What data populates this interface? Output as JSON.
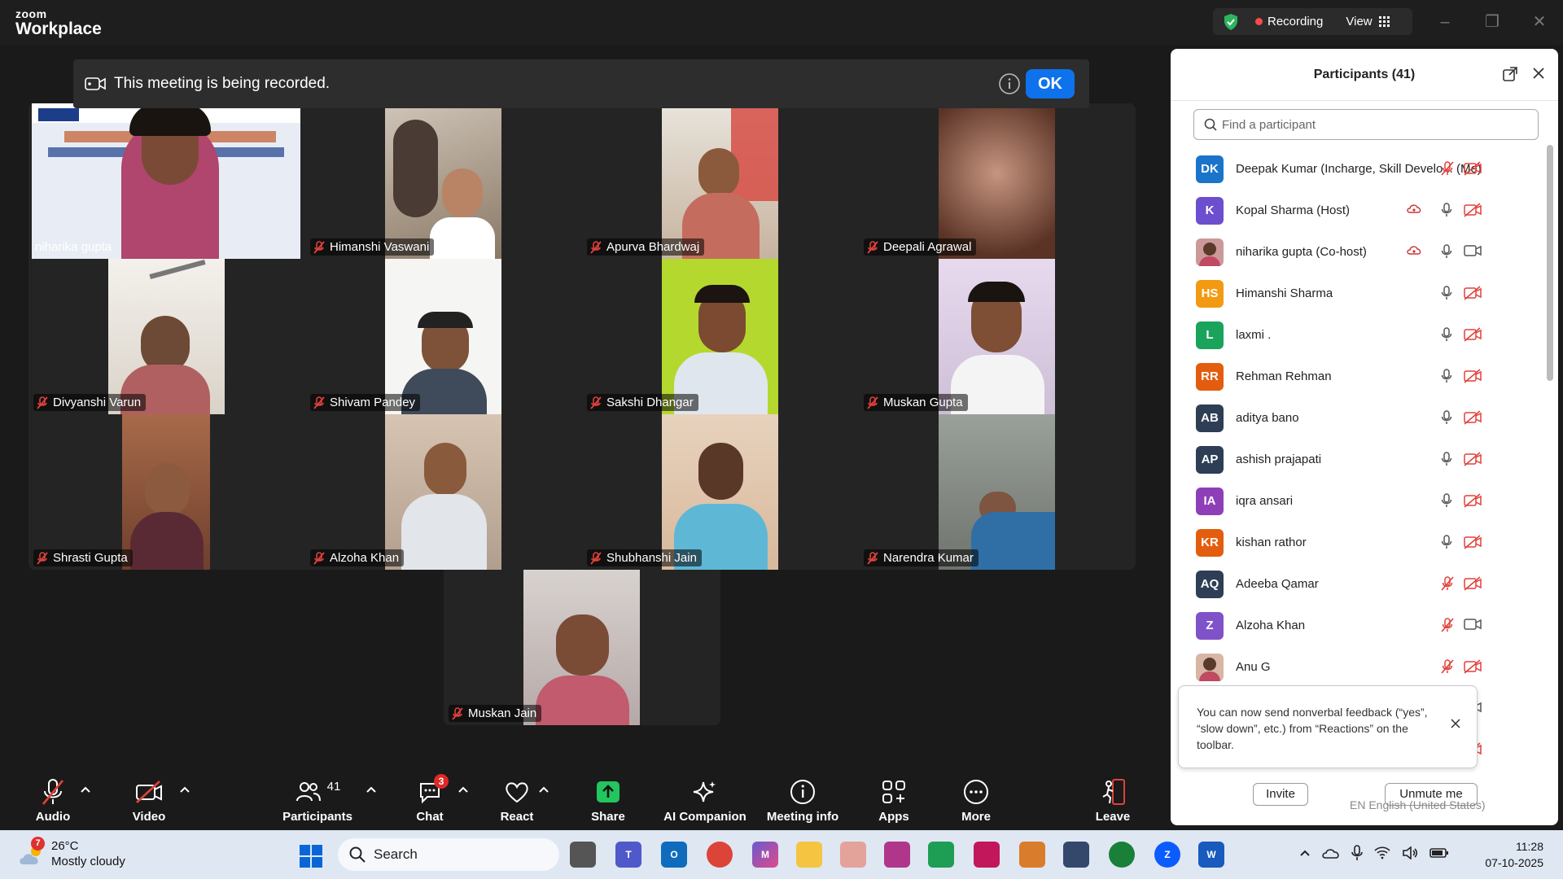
{
  "app": {
    "brand_top": "zoom",
    "brand_bottom": "Workplace"
  },
  "topbar": {
    "recording_label": "Recording",
    "view_label": "View"
  },
  "banner": {
    "text": "This meeting is being recorded.",
    "ok_label": "OK"
  },
  "colors": {
    "accent": "#0e72ed",
    "recording": "#ff4a4a",
    "muted_icon": "#e0413a",
    "shield": "#2db55d"
  },
  "video_tiles": [
    {
      "name": "niharika gupta",
      "muted": false
    },
    {
      "name": "Himanshi Vaswani",
      "muted": true
    },
    {
      "name": "Apurva Bhardwaj",
      "muted": true
    },
    {
      "name": "Deepali Agrawal",
      "muted": true
    },
    {
      "name": "Divyanshi Varun",
      "muted": true
    },
    {
      "name": "Shivam Pandey",
      "muted": true
    },
    {
      "name": "Sakshi Dhangar",
      "muted": true
    },
    {
      "name": "Muskan Gupta",
      "muted": true
    },
    {
      "name": "Shrasti Gupta",
      "muted": true
    },
    {
      "name": "Alzoha Khan",
      "muted": true
    },
    {
      "name": "Shubhanshi Jain",
      "muted": true
    },
    {
      "name": "Narendra Kumar",
      "muted": true
    },
    {
      "name": "Muskan Jain",
      "muted": true
    }
  ],
  "participants": {
    "title": "Participants (41)",
    "search_placeholder": "Find a participant",
    "list": [
      {
        "initials": "DK",
        "color": "#1a74c9",
        "name": "Deepak Kumar (Incharge, Skill Develo... (Me)",
        "mic": "muted",
        "video": "off",
        "cloud": false
      },
      {
        "initials": "K",
        "color": "#6b4fcf",
        "name": "Kopal Sharma (Host)",
        "mic": "on",
        "video": "off",
        "cloud": true
      },
      {
        "initials": "",
        "color": "#c99",
        "name": "niharika gupta (Co-host)",
        "mic": "on",
        "video": "on",
        "cloud": true
      },
      {
        "initials": "HS",
        "color": "#f29a12",
        "name": "Himanshi Sharma",
        "mic": "on",
        "video": "off",
        "cloud": false
      },
      {
        "initials": "L",
        "color": "#19a35b",
        "name": "laxmi .",
        "mic": "on",
        "video": "off",
        "cloud": false
      },
      {
        "initials": "RR",
        "color": "#e35d0f",
        "name": "Rehman Rehman",
        "mic": "on",
        "video": "off",
        "cloud": false
      },
      {
        "initials": "AB",
        "color": "#2d3e55",
        "name": "aditya bano",
        "mic": "on",
        "video": "off",
        "cloud": false
      },
      {
        "initials": "AP",
        "color": "#2d3e55",
        "name": "ashish prajapati",
        "mic": "on",
        "video": "off",
        "cloud": false
      },
      {
        "initials": "IA",
        "color": "#8e3fb8",
        "name": "iqra ansari",
        "mic": "on",
        "video": "off",
        "cloud": false
      },
      {
        "initials": "KR",
        "color": "#e35d0f",
        "name": "kishan rathor",
        "mic": "on",
        "video": "off",
        "cloud": false
      },
      {
        "initials": "AQ",
        "color": "#2d3e55",
        "name": "Adeeba Qamar",
        "mic": "muted",
        "video": "off",
        "cloud": false
      },
      {
        "initials": "Z",
        "color": "#7f52c9",
        "name": "Alzoha Khan",
        "mic": "muted",
        "video": "on",
        "cloud": false
      },
      {
        "initials": "",
        "color": "#d8b5a5",
        "name": "Anu G",
        "mic": "muted",
        "video": "off",
        "cloud": false
      }
    ],
    "tooltip": "You can now send nonverbal feedback (“yes”, “slow down”, etc.) from “Reactions” on the toolbar.",
    "invite_label": "Invite",
    "unmute_label": "Unmute me",
    "language_indicator": "EN English (United States)"
  },
  "toolbar": {
    "audio": "Audio",
    "video": "Video",
    "participants": "Participants",
    "participants_count": "41",
    "chat": "Chat",
    "chat_badge": "3",
    "react": "React",
    "share": "Share",
    "ai_companion": "AI Companion",
    "meeting_info": "Meeting info",
    "apps": "Apps",
    "more": "More",
    "leave": "Leave"
  },
  "taskbar": {
    "weather_temp": "26°C",
    "weather_desc": "Mostly cloudy",
    "weather_badge": "7",
    "search_label": "Search",
    "time": "11:28",
    "date": "07-10-2025"
  }
}
